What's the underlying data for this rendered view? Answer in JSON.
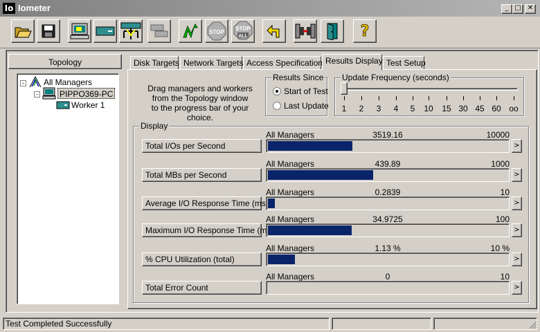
{
  "window": {
    "title": "Iometer",
    "icon_text": "Io"
  },
  "toolbar": {
    "buttons": [
      "open-icon",
      "save-icon",
      "new-manager-icon",
      "new-disk-worker-icon",
      "new-network-worker-icon",
      "duplicate-worker-icon",
      "start-icon",
      "stop-icon",
      "stop-all-icon",
      "reset-icon",
      "disconnect-icon",
      "exit-icon",
      "help-icon"
    ],
    "stop_label": "STOP",
    "stop_all_label": "STOP",
    "stop_all_sub": "ALL",
    "help_label": "?"
  },
  "topology": {
    "header": "Topology",
    "items": [
      {
        "label": "All Managers",
        "toggle": "-"
      },
      {
        "label": "PIPPO369-PC",
        "toggle": "-"
      },
      {
        "label": "Worker 1"
      }
    ]
  },
  "tabs": [
    "Disk Targets",
    "Network Targets",
    "Access Specifications",
    "Results Display",
    "Test Setup"
  ],
  "active_tab": "Results Display",
  "hint": {
    "line1": "Drag managers and workers",
    "line2": "from the Topology window",
    "line3": "to the progress bar of your choice."
  },
  "results_since": {
    "title": "Results Since",
    "options": [
      "Start of Test",
      "Last Update"
    ],
    "selected": "Start of Test"
  },
  "update_frequency": {
    "title": "Update Frequency (seconds)",
    "ticks": [
      "1",
      "2",
      "3",
      "4",
      "5",
      "10",
      "15",
      "30",
      "45",
      "60",
      "oo"
    ],
    "value": "1"
  },
  "display": {
    "title": "Display",
    "metrics": [
      {
        "button": "Total I/Os per Second",
        "source": "All Managers",
        "value": "3519.16",
        "max": "10000",
        "fraction": 0.3519
      },
      {
        "button": "Total MBs per Second",
        "source": "All Managers",
        "value": "439.89",
        "max": "1000",
        "fraction": 0.4399
      },
      {
        "button": "Average I/O Response Time (ms)",
        "source": "All Managers",
        "value": "0.2839",
        "max": "10",
        "fraction": 0.0284
      },
      {
        "button": "Maximum I/O Response Time (ms)",
        "source": "All Managers",
        "value": "34.9725",
        "max": "100",
        "fraction": 0.3497
      },
      {
        "button": "% CPU Utilization (total)",
        "source": "All Managers",
        "value": "1.13 %",
        "max": "10 %",
        "fraction": 0.113
      },
      {
        "button": "Total Error Count",
        "source": "All Managers",
        "value": "0",
        "max": "10",
        "fraction": 0
      }
    ],
    "arrow": ">"
  },
  "status": {
    "text": "Test Completed Successfully"
  },
  "colors": {
    "bar": "#0a246a",
    "face": "#d4d0c8"
  }
}
